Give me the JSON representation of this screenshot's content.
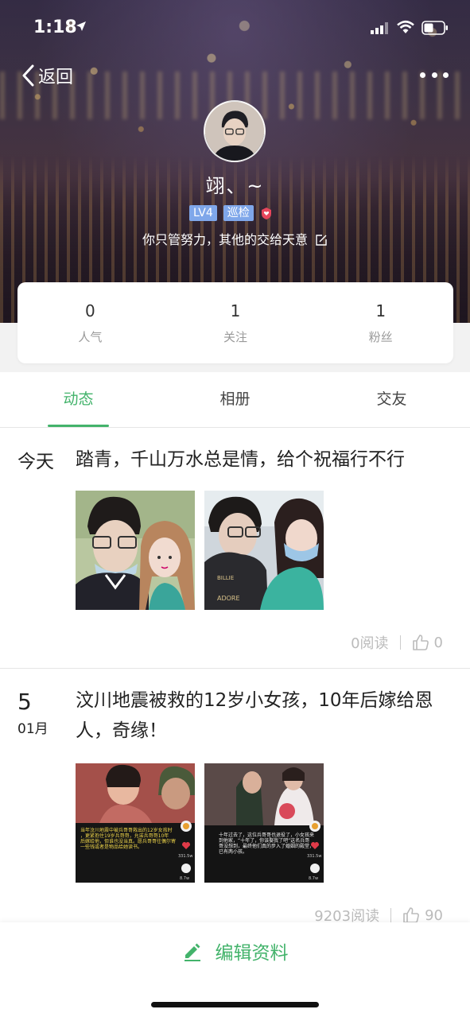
{
  "status_bar": {
    "time": "1:18"
  },
  "nav": {
    "back_label": "返回"
  },
  "profile": {
    "nickname": "翊、~",
    "level_badge": "LV4",
    "role_badge": "巡检",
    "signature": "你只管努力，其他的交给天意"
  },
  "stats": [
    {
      "value": "0",
      "label": "人气"
    },
    {
      "value": "1",
      "label": "关注"
    },
    {
      "value": "1",
      "label": "粉丝"
    }
  ],
  "tabs": [
    {
      "label": "动态",
      "active": true
    },
    {
      "label": "相册",
      "active": false
    },
    {
      "label": "交友",
      "active": false
    }
  ],
  "posts": [
    {
      "date": "今天",
      "text": "踏青，千山万水总是情，给个祝福行不行",
      "reads": "0阅读",
      "likes": "0"
    },
    {
      "day": "5",
      "month": "01月",
      "text": "汶川地震被救的12岁小女孩，10年后嫁给恩人，奇缘！",
      "reads": "9203阅读",
      "likes": "90",
      "photo_captions": [
        "当年汶川地震中被兵哥哥救出的12岁女孩时，更紧抱住19岁兵哥哥，允诺兵哥哥10年后嫁给他，但谁也没当真。愿兵哥哥往偶尔寄一些钱或者是物品给她读书。",
        "十年过去了，这位兵哥哥也退役了，小女孩来到他家，“十年了，你该娶我了吧”这名兵哥哥没想到，最终他们真的步入了婚姻的殿堂，已有两小孩。"
      ],
      "photo_counts": [
        "331.5w",
        "8.7w",
        "331.5w",
        "8.7w"
      ]
    }
  ],
  "bottom_bar": {
    "edit_label": "编辑资料"
  },
  "colors": {
    "accent": "#43b36b",
    "badge_blue": "#7fa7ea",
    "muted": "#bbbbbb"
  }
}
